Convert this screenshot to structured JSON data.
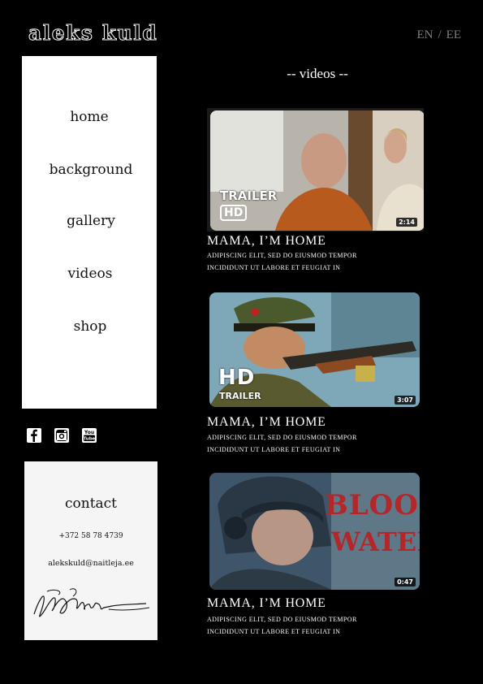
{
  "header": {
    "logo": "aleks kuld",
    "lang_en": "EN",
    "lang_sep": "/",
    "lang_ee": "EE"
  },
  "nav": {
    "items": [
      {
        "label": "home"
      },
      {
        "label": "background"
      },
      {
        "label": "gallery"
      },
      {
        "label": "videos"
      },
      {
        "label": "shop"
      }
    ]
  },
  "social": {
    "icons": [
      "facebook-icon",
      "instagram-icon",
      "youtube-icon"
    ]
  },
  "contact": {
    "title": "contact",
    "phone": "+372 58 78 4739",
    "email": "alekskuld@naitleja.ee"
  },
  "main": {
    "section_title": "-- videos --",
    "videos": [
      {
        "title": "MAMA, I’M HOME",
        "desc_line1": "ADIPISCING ELIT, SED DO EIUSMOD TEMPOR",
        "desc_line2": "INCIDIDUNT UT LABORE ET FEUGIAT IN",
        "duration": "2:14",
        "badge_top": "TRAILER",
        "badge_bottom": "HD"
      },
      {
        "title": "MAMA, I’M HOME",
        "desc_line1": "ADIPISCING ELIT, SED DO EIUSMOD TEMPOR",
        "desc_line2": "INCIDIDUNT UT LABORE ET FEUGIAT IN",
        "duration": "3:07",
        "badge_top": "HD",
        "badge_bottom": "TRAILER"
      },
      {
        "title": "MAMA, I’M HOME",
        "desc_line1": "ADIPISCING ELIT, SED DO EIUSMOD TEMPOR",
        "desc_line2": "INCIDIDUNT UT LABORE ET FEUGIAT IN",
        "duration": "0:47",
        "badge_top": "BLOOD",
        "badge_bottom": "WATER"
      }
    ]
  },
  "colors": {
    "background": "#000000",
    "panel": "#ffffff",
    "contact_panel": "#f5f5f5",
    "lang": "#7e7e7e",
    "blood_red": "#b3262a"
  }
}
